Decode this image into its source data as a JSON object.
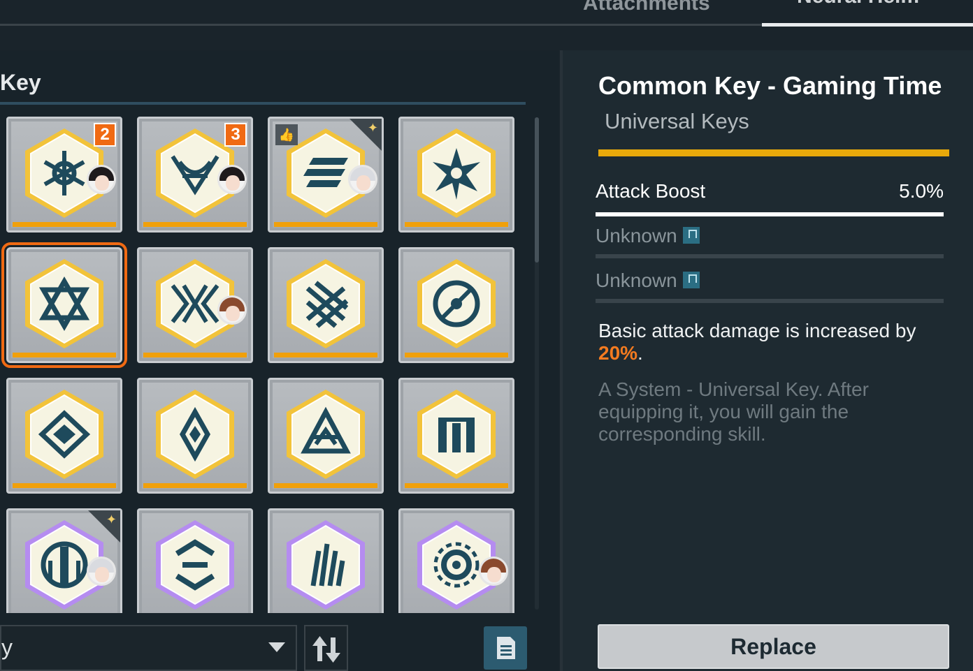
{
  "tabs": [
    {
      "label": "Attachments",
      "active": false
    },
    {
      "label": "Neural Helm",
      "active": true
    }
  ],
  "left": {
    "section_title": "Key",
    "filter_label": "y",
    "grid": [
      {
        "badge": "2",
        "avatar": "dark-hair",
        "rarity": "gold",
        "emblem": "snowflake"
      },
      {
        "badge": "3",
        "avatar": "dark-hair",
        "rarity": "gold",
        "emblem": "weave"
      },
      {
        "thumb": true,
        "corner": true,
        "avatar": "white-hair",
        "rarity": "gold",
        "emblem": "stripes"
      },
      {
        "rarity": "gold",
        "emblem": "star"
      },
      {
        "selected": true,
        "rarity": "gold",
        "emblem": "hexagram"
      },
      {
        "avatar": "brown-hair",
        "rarity": "gold",
        "emblem": "wings"
      },
      {
        "rarity": "gold",
        "emblem": "lattice"
      },
      {
        "rarity": "gold",
        "emblem": "eye"
      },
      {
        "rarity": "gold",
        "emblem": "diamond"
      },
      {
        "rarity": "gold",
        "emblem": "rhombus"
      },
      {
        "rarity": "gold",
        "emblem": "peak"
      },
      {
        "rarity": "gold",
        "emblem": "pillars"
      },
      {
        "corner": true,
        "avatar": "white-hair",
        "rarity": "purple",
        "emblem": "circuit"
      },
      {
        "rarity": "purple",
        "emblem": "arrows"
      },
      {
        "rarity": "purple",
        "emblem": "spikes"
      },
      {
        "avatar": "brown-hair",
        "rarity": "purple",
        "emblem": "gear"
      }
    ]
  },
  "detail": {
    "title": "Common Key - Gaming Time",
    "subtitle": "Universal Keys",
    "stats": [
      {
        "label": "Attack Boost",
        "value": "5.0%"
      },
      {
        "label": "Unknown"
      },
      {
        "label": "Unknown"
      }
    ],
    "effect_text": "Basic attack damage is increased by ",
    "effect_value": "20%",
    "effect_end": ".",
    "flavor": "A System - Universal Key. After equipping it, you will gain the corresponding skill.",
    "replace_label": "Replace"
  },
  "colors": {
    "accent_orange": "#f06a13",
    "gold": "#e8a90b",
    "purple": "#b58cf0",
    "teal": "#2c5b70"
  }
}
